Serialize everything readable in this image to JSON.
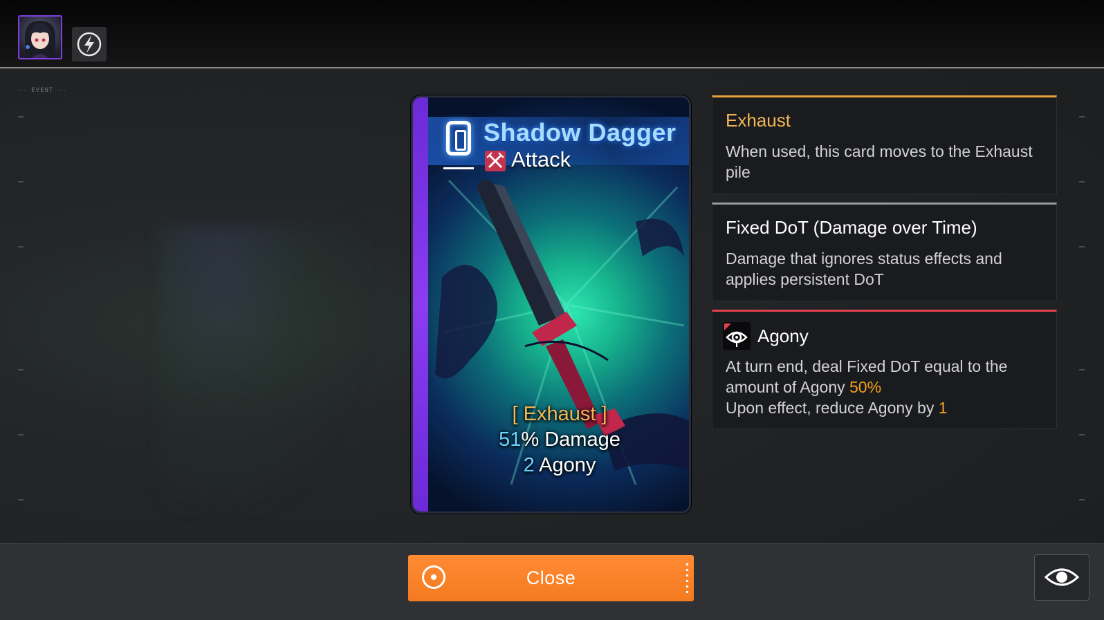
{
  "side_label": "-- EVENT --",
  "card": {
    "name": "Shadow Dagger",
    "type": "Attack",
    "keyword": "[ Exhaust ]",
    "damage_value": "51",
    "damage_suffix": "% Damage",
    "agony_value": "2",
    "agony_suffix": " Agony"
  },
  "panels": {
    "exhaust": {
      "title": "Exhaust",
      "desc": "When used, this card moves to the Exhaust pile"
    },
    "fixed_dot": {
      "title": "Fixed DoT (Damage over Time)",
      "desc": "Damage that ignores status effects and applies persistent DoT"
    },
    "agony": {
      "title": "Agony",
      "desc_line1_prefix": "At turn end, deal Fixed DoT equal to the amount of Agony ",
      "desc_line1_highlight": "50%",
      "desc_line2_prefix": "Upon effect, reduce Agony by ",
      "desc_line2_highlight": "1"
    }
  },
  "bottom": {
    "close_label": "Close"
  },
  "colors": {
    "accent_orange": "#f47a20",
    "exhaust_gold": "#f2b655",
    "highlight": "#f2a21b",
    "agony_red": "#e3404f",
    "card_purple": "#8a3cf0"
  },
  "icons": {
    "avatar": "character-portrait",
    "skill": "lightning-icon",
    "card_type": "crossed-swords-icon",
    "agony": "eye-icon",
    "close": "target-circle-icon",
    "view": "eye-icon"
  }
}
